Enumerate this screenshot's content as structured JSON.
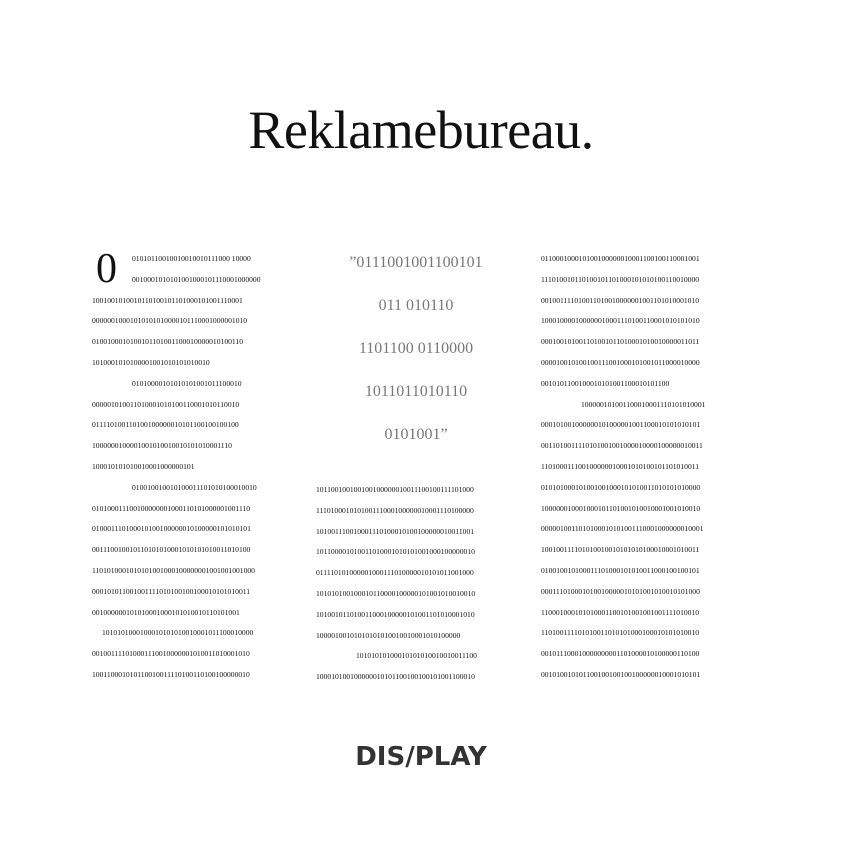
{
  "title": "Reklamebureau.",
  "dropcap": "0",
  "col1": [
    "01010110010010010010111000      10000",
    "0010001010101001000101110001000000",
    "1001001010010110100101101000101001110001",
    "0000001000101010101000010111000100000101​0",
    "0100100010100101101001100010000010100110",
    "1010001010100001001010101010010",
    "01010000101010101001011100010",
    "0000010100110100010101001100010101100​10",
    "01111010011010010000001010110010010010​0",
    "10000001000010010100100101010100011​10",
    "10001010101001000100000010​1",
    "0100100100101000111010101000100​10",
    "01010001110010000000100011010100000100​1110",
    "0100011101000101001000000101000001010101​01",
    "00111001001011010101000101010101001101010​0",
    "11010100010101010010001000000010010010​01000",
    "00010101100100111101010010010001010101001​1",
    "001000000101010001000101010010110101001",
    "1010101000100010101010010001011100010000",
    "00100111101000111001000000101001101000101​0",
    "1001100010101100100111101001101001000000​10"
  ],
  "quote": [
    "”0111001001100101",
    "011 010110",
    "1101100 0110000",
    "1011011010110",
    "0101001”"
  ],
  "col2": [
    "1011001001001001000000100111001001111010​00",
    "1110100010101001110001000000100011101000​00",
    "1010011100100011101000101001000000100110​01",
    "1011000010100110100010101010010001000000​10",
    "0111101010000010001110100000101010110010​00",
    "1010101001000101100001000001010010100100​10",
    "1010010110100110001000001010011010100010​10",
    "100001001010101010100100100010101000​00",
    "101010101000101010100100100111​00",
    "1000101001000000101011001001001010011000​10"
  ],
  "col3": [
    "01100010001010010000001000110010011000100​1",
    "11101001011010010110100010101010011001000​0",
    "00100111101001101001000000100110101000101​0",
    "10001000010000001000111010011000101010101​0",
    "00010010100110100101101000101001000001101​1",
    "00001001010010011100100010100101100001000​0",
    "00101011001000101010011000101011​00",
    "1000001010011000100011101010100​01",
    "0001010010000001010000010011000101010101​01",
    "00110100111101010010010000100001000000100​11",
    "11010001110010000001000101010010110101001​1",
    "01010100010100100100010101001101010101000​0",
    "10000001000100010110100101001000100101001​0",
    "00000100110101000101010011100010000000100​01",
    "10010011110101001001010101010001000101001​1",
    "01001001010001110100010101001100010010010​1",
    "00011101000101001000001010100101001010100​0",
    "11000100010101000110010100100100111101001​0",
    "11010011110101001101010100010001010101001​0",
    "00101110001000000000110100001010000011010​0",
    "00101001010110010010010010000001000101010​1"
  ],
  "logo": "DIS/PLAY"
}
